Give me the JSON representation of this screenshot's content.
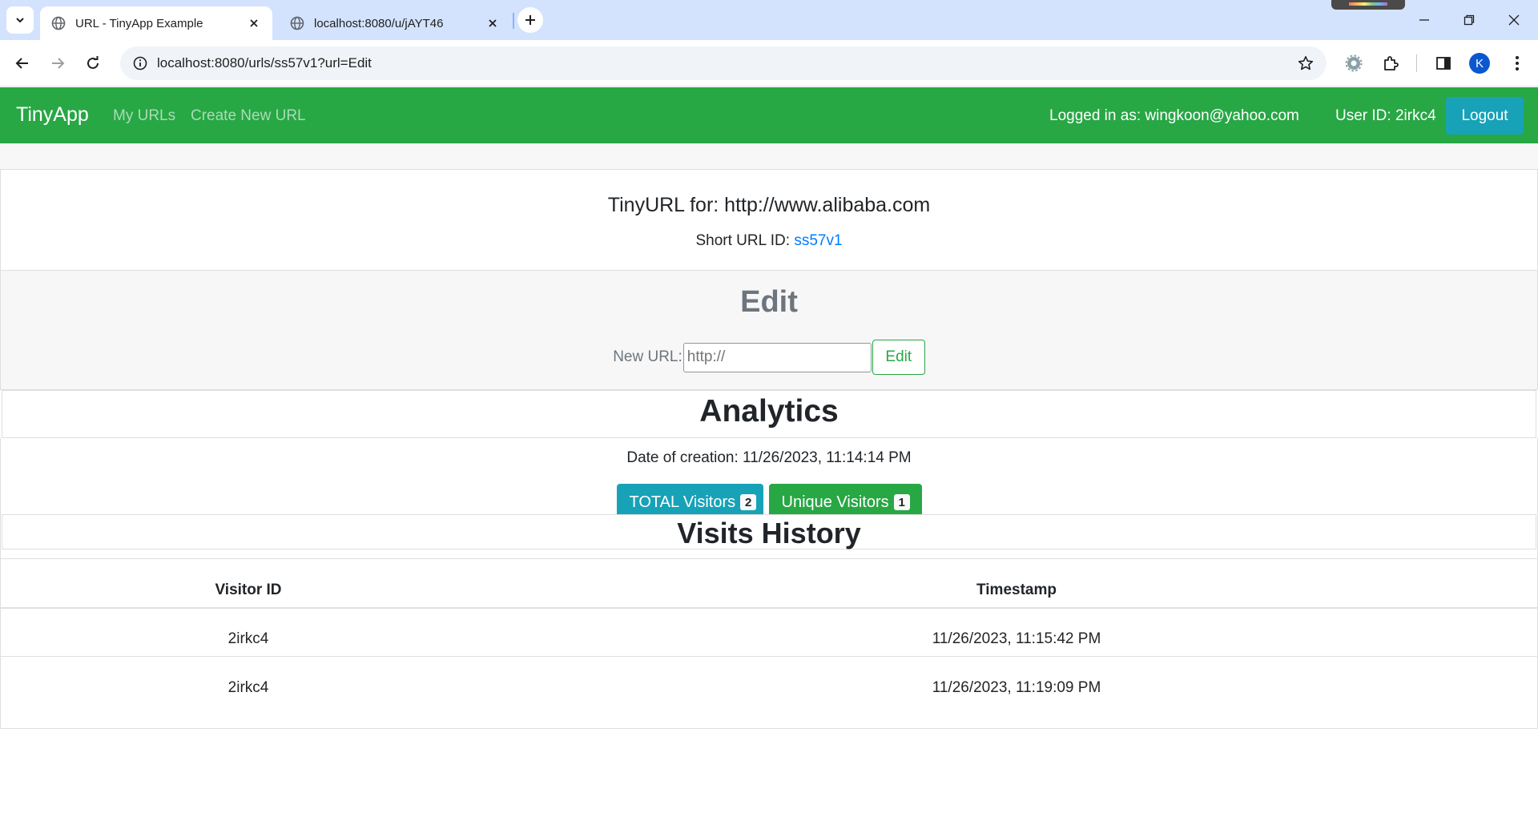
{
  "browser": {
    "tabs": [
      {
        "title": "URL - TinyApp Example",
        "active": true
      },
      {
        "title": "localhost:8080/u/jAYT46",
        "active": false
      }
    ],
    "address": "localhost:8080/urls/ss57v1?url=Edit",
    "profile_initial": "K"
  },
  "navbar": {
    "brand": "TinyApp",
    "links": [
      "My URLs",
      "Create New URL"
    ],
    "logged_in": "Logged in as: wingkoon@yahoo.com",
    "user_id": "User ID: 2irkc4",
    "logout": "Logout"
  },
  "url_card": {
    "title": "TinyURL for: http://www.alibaba.com",
    "short_label": "Short URL ID: ",
    "short_id": "ss57v1"
  },
  "edit": {
    "heading": "Edit",
    "label": "New URL:",
    "placeholder": "http://",
    "button": "Edit"
  },
  "analytics": {
    "title": "Analytics",
    "date_created": "Date of creation: 11/26/2023, 11:14:14 PM",
    "total_label": "TOTAL Visitors",
    "total_count": "2",
    "unique_label": "Unique Visitors",
    "unique_count": "1"
  },
  "history": {
    "title": "Visits History",
    "columns": [
      "Visitor ID",
      "Timestamp"
    ],
    "rows": [
      {
        "visitor": "2irkc4",
        "timestamp": "11/26/2023, 11:15:42 PM"
      },
      {
        "visitor": "2irkc4",
        "timestamp": "11/26/2023, 11:19:09 PM"
      }
    ]
  },
  "colors": {
    "navbar": "#28a745",
    "info": "#17a2b8",
    "link": "#007bff"
  }
}
